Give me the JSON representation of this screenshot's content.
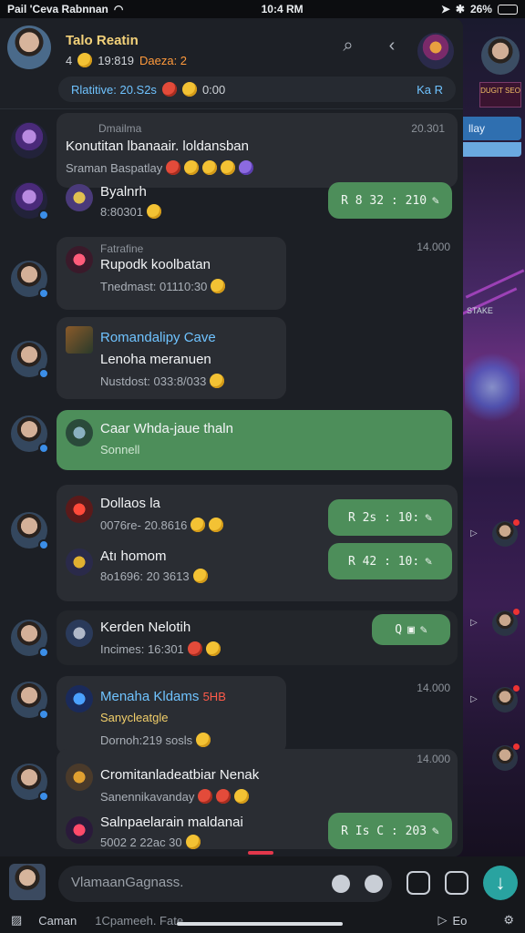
{
  "status": {
    "carrier": "Pail 'Ceva Rabnnan",
    "time": "10:4 RM",
    "battery": "26%"
  },
  "header": {
    "title": "Talo Reatin",
    "sub_left": "4",
    "sub_time": "19:819",
    "sub_tag": "Daeza: 2",
    "filter_label": "Rlatitive: 20.S2s",
    "filter_time": "0:00",
    "filter_right": "Ka R"
  },
  "side": {
    "badge": "DUGIT SEO",
    "tab": "llay",
    "mini": "STAKE"
  },
  "messages": [
    {
      "pre": "Dmailma",
      "title": "Konutitan lbanaair. loldansban",
      "sub": "Sraman Baspatlay",
      "time": "20.301"
    },
    {
      "title": "Byalnrh",
      "sub": "8:80301",
      "pill": "R 8 32 : 210"
    },
    {
      "pre": "Fatrafine",
      "title": "Rupodk koolbatan",
      "sub": "Tnedmast: 01110:30",
      "time": "14.000"
    },
    {
      "title": "Romandalipy Cave",
      "title2": "Lenoha meranuen",
      "sub": "Nustdost: 033:8/033"
    },
    {
      "title": "Caar Whda-jaue thaln",
      "sub": "Sonnell"
    },
    {
      "title": "Dollaos la",
      "sub": "0076re- 20.8616",
      "pill": "R 2s : 10:"
    },
    {
      "title": "Atı homom",
      "sub": "8o1696: 20 3613",
      "pill": "R 42 : 10:"
    },
    {
      "title": "Kerden Nelotih",
      "sub": "Incimes: 16:301",
      "pill": "Q"
    },
    {
      "title": "Menaha Kldams",
      "title_red": "5HB",
      "sub": "Sanycleatgle",
      "sub2": "Dornoh:219 sosls",
      "time": "14.000"
    },
    {
      "title": "Cromitanladeatbiar Nenak",
      "sub": "Sanennikavanday",
      "time": "14.000"
    },
    {
      "title": "Salnpaelarain maldanai",
      "sub": "5002 2 22ac 30",
      "pill": "R Is C : 203"
    }
  ],
  "composer": {
    "placeholder": "VlamaanGagnass.",
    "foot_left": "Caman",
    "foot_mid": "1Cpameeh. Fate",
    "foot_right": "Eo"
  }
}
